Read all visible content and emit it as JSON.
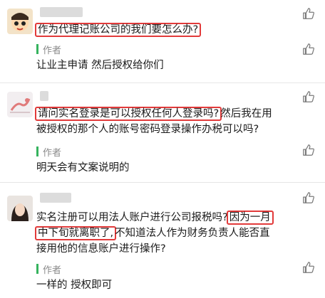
{
  "comments": [
    {
      "text_hl": "作为代理记账公司的我们要怎么办?",
      "author_tag": "作者",
      "reply": "让业主申请 然后授权给你们"
    },
    {
      "line1_hl": "请问实名登录是可以授权任何人登录吗?",
      "line1_rest": "然后我在用",
      "line2": "被授权的那个人的账号密码登录操作办税可以吗?",
      "author_tag": "作者",
      "reply": "明天会有文案说明的"
    },
    {
      "line1_a": "实名注册可以用法人账户进行公司报税吗?",
      "line1_hl": "因为一月",
      "line2_hl": "中下旬就离职了,",
      "line2_rest": "不知道法人作为财务负责人能否直",
      "line3": "接用他的信息账户进行操作?",
      "author_tag": "作者",
      "reply": "一样的 授权即可"
    }
  ],
  "icons": {
    "like": "thumbs-up-icon"
  },
  "colors": {
    "highlight_border": "#e23a3a",
    "author_accent": "#35b35e",
    "muted_text": "#8a8a8a"
  }
}
